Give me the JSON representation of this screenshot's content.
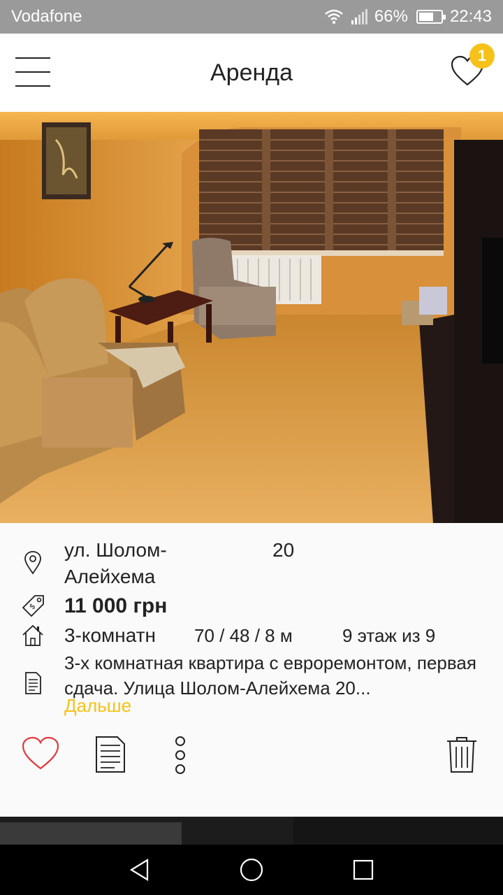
{
  "status_bar": {
    "carrier": "Vodafone",
    "battery": "66%",
    "battery_level": 0.66,
    "time": "22:43"
  },
  "app_bar": {
    "title": "Аренда",
    "favorites_count": "1"
  },
  "listing": {
    "address_line1": "ул. Шолом-",
    "address_line2": "Алейхема",
    "house_number": "20",
    "price": "11 000 грн",
    "rooms": "3-комнатн",
    "area": "70 / 48 / 8 м",
    "floor": "9 этаж из 9",
    "description": "3-х комнатная квартира с евроремонтом, первая сдача. Улица Шолом-Алейхема 20...",
    "more_label": "Дальше"
  },
  "colors": {
    "accent": "#f6c219",
    "favorite": "#e0393e"
  },
  "icons": [
    "menu-icon",
    "heart-icon",
    "location-pin-icon",
    "price-tag-icon",
    "house-icon",
    "document-icon",
    "more-vertical-icon",
    "trash-icon",
    "back-icon",
    "home-icon",
    "recents-icon"
  ]
}
